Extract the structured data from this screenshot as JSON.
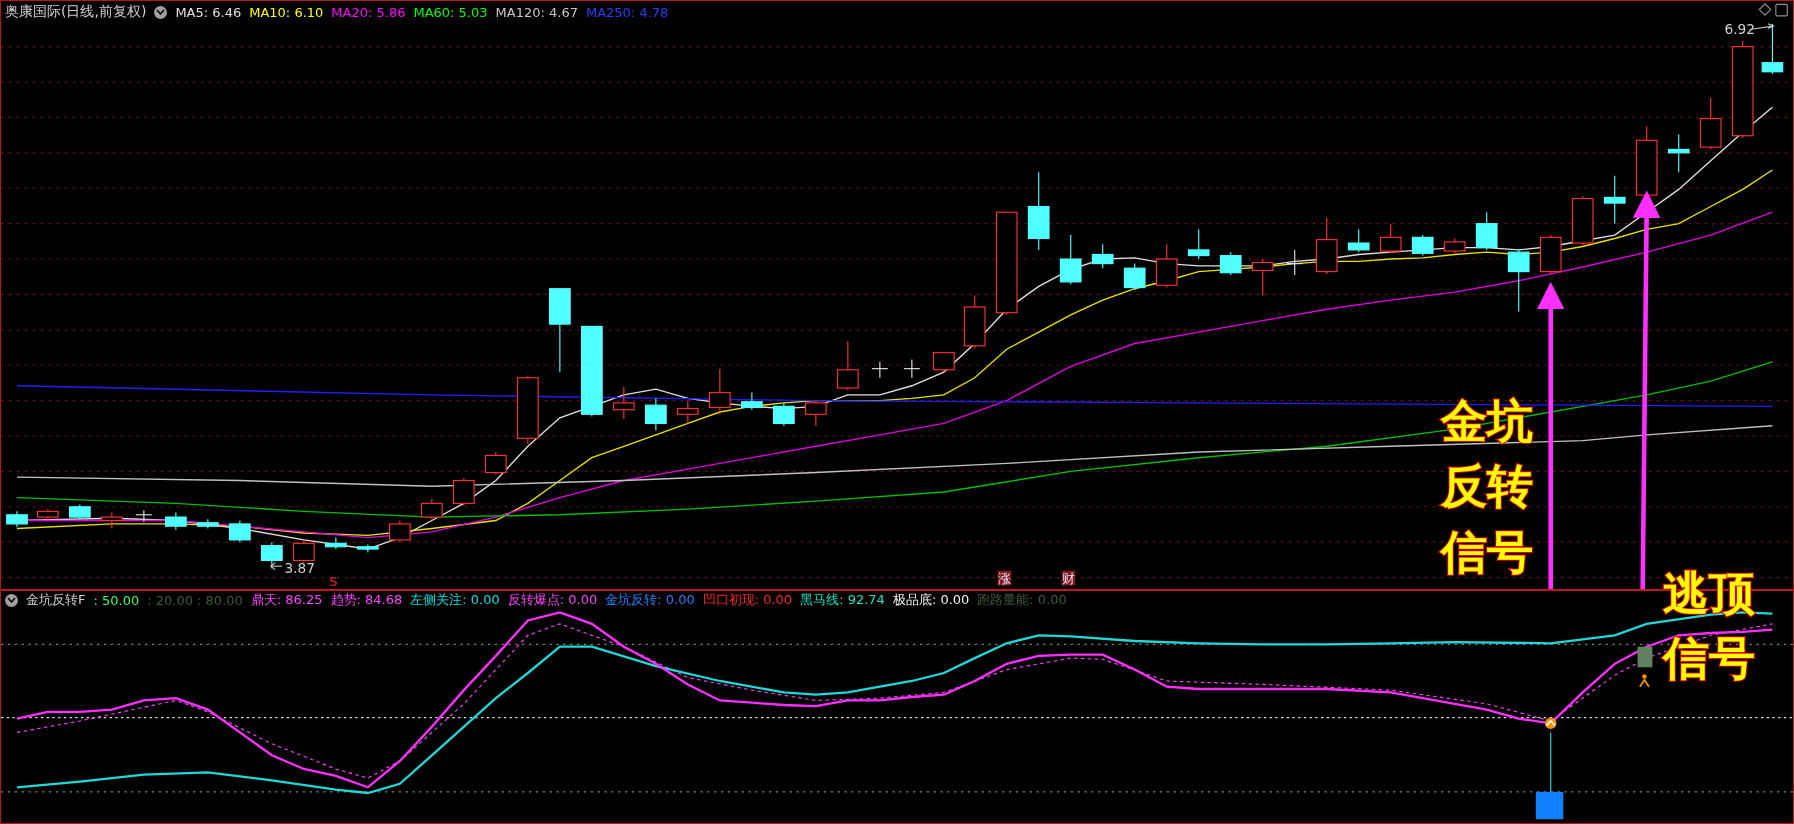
{
  "chart_header": {
    "title": "奥康国际(日线,前复权)",
    "averages": [
      {
        "label": "MA5: 6.46",
        "color": "#e0e0e0"
      },
      {
        "label": "MA10: 6.10",
        "color": "#ffff00"
      },
      {
        "label": "MA20: 5.86",
        "color": "#ff00ff"
      },
      {
        "label": "MA60: 5.03",
        "color": "#00ff00"
      },
      {
        "label": "MA120: 4.67",
        "color": "#c8c8c8"
      },
      {
        "label": "MA250: 4.78",
        "color": "#2040ff"
      }
    ]
  },
  "price_labels": {
    "high": "6.92",
    "low": "3.87"
  },
  "markers": [
    {
      "text": "S",
      "kind": "signal"
    },
    {
      "text": "涨",
      "kind": "badge"
    },
    {
      "text": "财",
      "kind": "badge"
    }
  ],
  "indicator_header": {
    "name": "金坑反转F",
    "items": [
      {
        "label": ": 50.00",
        "color": "#40ff40"
      },
      {
        "label": ": 20.00 : 80.00",
        "color": "#3c5a3c"
      },
      {
        "label": "鼎天: 86.25",
        "color": "#ff40ff"
      },
      {
        "label": "趋势: 84.68",
        "color": "#ff40ff"
      },
      {
        "label": "左侧关注: 0.00",
        "color": "#00e0e0"
      },
      {
        "label": "反转爆点: 0.00",
        "color": "#ff40ff"
      },
      {
        "label": "金坑反转: 0.00",
        "color": "#2080ff"
      },
      {
        "label": "凹口初现: 0.00",
        "color": "#ff2020"
      },
      {
        "label": "黑马线: 92.74",
        "color": "#20e0c0"
      },
      {
        "label": "极品底: 0.00",
        "color": "#f0f0f0"
      },
      {
        "label": "跑路量能: 0.00",
        "color": "#3c5a3c"
      }
    ]
  },
  "annotations": [
    {
      "lines": [
        "金坑",
        "反转",
        "信号"
      ]
    },
    {
      "lines": [
        "逃顶",
        "信号"
      ]
    }
  ]
}
